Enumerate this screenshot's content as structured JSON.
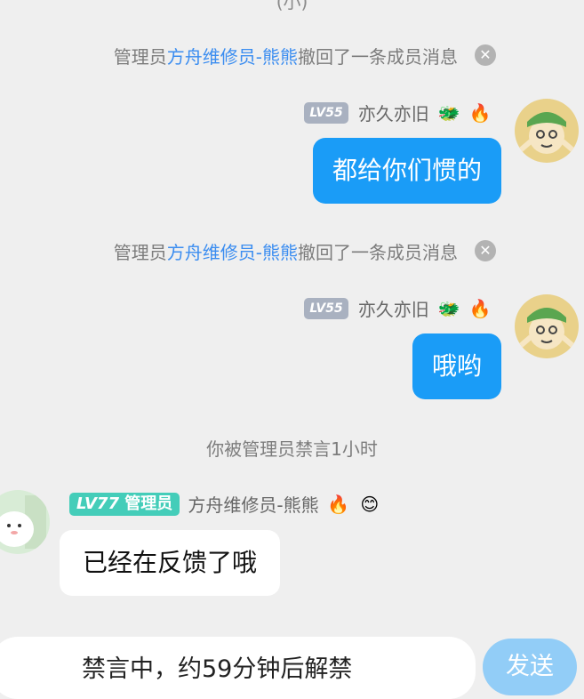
{
  "top_partial": "(小)",
  "messages": [
    {
      "system": {
        "prefix": "管理员",
        "admin": "方舟维修员-熊熊",
        "suffix": "撤回了一条成员消息"
      },
      "sender": {
        "level": "LV55",
        "name": "亦久亦旧",
        "badges": [
          "🐲",
          "🔥"
        ]
      },
      "text": "都给你们惯的"
    },
    {
      "system": {
        "prefix": "管理员",
        "admin": "方舟维修员-熊熊",
        "suffix": "撤回了一条成员消息"
      },
      "sender": {
        "level": "LV55",
        "name": "亦久亦旧",
        "badges": [
          "🐲",
          "🔥"
        ]
      },
      "text": "哦哟"
    }
  ],
  "notice": "你被管理员禁言1小时",
  "incoming": {
    "level": "LV77",
    "role": "管理员",
    "name": "方舟维修员-熊熊",
    "badges": [
      "🔥",
      "😊"
    ],
    "text": "已经在反馈了哦"
  },
  "bottom": {
    "mute_text": "禁言中，约59分钟后解禁",
    "send_label": "发送"
  },
  "colors": {
    "bubble_blue": "#1a9cf7",
    "link_blue": "#3b8df0",
    "send_disabled": "#92cdf7",
    "admin_green": "#44cdb9",
    "background": "#efefef"
  },
  "icons": {
    "close": "close-icon",
    "dragon_badge": "dragon-icon",
    "fire_badge": "fire-icon",
    "smile_badge": "smile-icon"
  }
}
